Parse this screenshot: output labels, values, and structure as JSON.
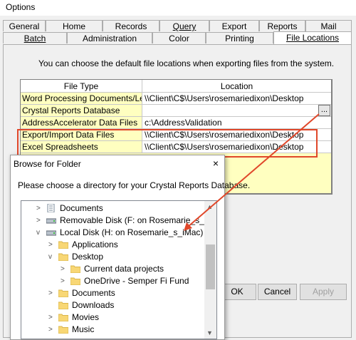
{
  "window": {
    "title": "Options"
  },
  "tabs_row1": [
    "General",
    "Home",
    "Records",
    "Query",
    "Export",
    "Reports",
    "Mail"
  ],
  "tabs_row2": [
    "Batch",
    "Administration",
    "Color",
    "Printing",
    "File Locations"
  ],
  "active_tab": "File Locations",
  "intro": "You can choose the default file locations when exporting files from the system.",
  "grid": {
    "headers": [
      "File Type",
      "Location"
    ],
    "rows": [
      {
        "type": "Word Processing Documents/Letters",
        "location": "\\\\Client\\C$\\Users\\rosemariedixon\\Desktop"
      },
      {
        "type": "Crystal Reports Database",
        "location": "",
        "browse": "..."
      },
      {
        "type": "AddressAccelerator Data Files",
        "location": "c:\\AddressValidation"
      },
      {
        "type": "Export/Import Data Files",
        "location": "\\\\Client\\C$\\Users\\rosemariedixon\\Desktop"
      },
      {
        "type": "Excel Spreadsheets",
        "location": "\\\\Client\\C$\\Users\\rosemariedixon\\Desktop"
      }
    ]
  },
  "buttons": {
    "ok": "OK",
    "cancel": "Cancel",
    "apply": "Apply"
  },
  "browse_dialog": {
    "title": "Browse for Folder",
    "close": "×",
    "description": "Please choose a directory for your Crystal Reports Database.",
    "tree": [
      {
        "label": "Documents",
        "icon": "documents-icon",
        "expander": ">"
      },
      {
        "label": "Removable Disk (F: on Rosemarie_s_iMac)",
        "icon": "drive-icon",
        "expander": ">"
      },
      {
        "label": "Local Disk (H: on Rosemarie_s_iMac)",
        "icon": "drive-icon",
        "expander": "v"
      },
      {
        "label": "Applications",
        "icon": "folder-icon",
        "expander": ">"
      },
      {
        "label": "Desktop",
        "icon": "folder-icon",
        "expander": "v"
      },
      {
        "label": "Current data projects",
        "icon": "folder-icon",
        "expander": ">"
      },
      {
        "label": "OneDrive - Semper Fi Fund",
        "icon": "folder-icon",
        "expander": ">"
      },
      {
        "label": "Documents",
        "icon": "folder-icon",
        "expander": ">"
      },
      {
        "label": "Downloads",
        "icon": "folder-icon",
        "expander": ""
      },
      {
        "label": "Movies",
        "icon": "folder-icon",
        "expander": ">"
      },
      {
        "label": "Music",
        "icon": "folder-icon",
        "expander": ">"
      }
    ]
  },
  "colors": {
    "accent": "#e0472a",
    "grid_type_bg": "#ffffc0",
    "folder": "#f8d775"
  }
}
